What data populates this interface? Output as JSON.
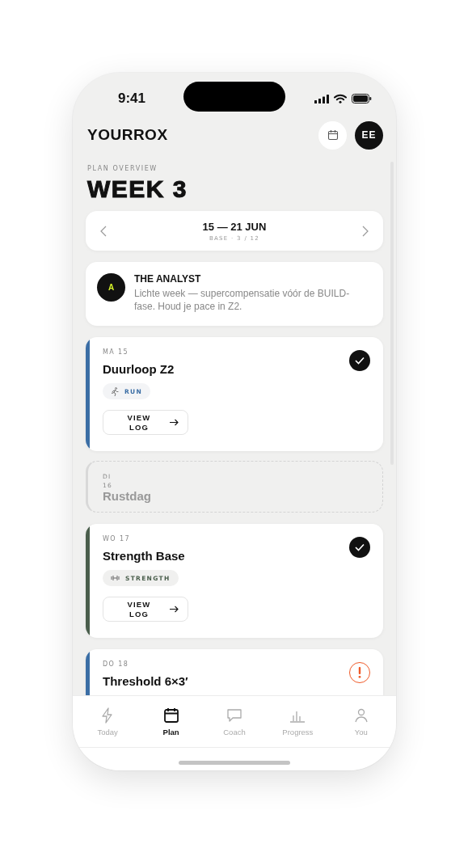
{
  "status_bar": {
    "time": "9:41"
  },
  "header": {
    "logo": "YOURROX",
    "avatar": "EE"
  },
  "overview": {
    "label": "PLAN OVERVIEW",
    "title": "WEEK 3"
  },
  "week_nav": {
    "range": "15 — 21 JUN",
    "phase": "BASE · 3 / 12"
  },
  "coach_note": {
    "avatar": "A",
    "title": "THE ANALYST",
    "text": "Lichte week — supercompensatie vóór de BUILD-fase. Houd je pace in Z2."
  },
  "days": [
    {
      "kind": "workout",
      "day": "MA 15",
      "title": "Duurloop Z2",
      "color": "#3b6ea5",
      "completed": true,
      "warning": false,
      "tag": {
        "kind": "run",
        "label": "RUN"
      },
      "action": "VIEW LOG"
    },
    {
      "kind": "rest",
      "day": "DI 16",
      "title": "Rustdag"
    },
    {
      "kind": "workout",
      "day": "WO 17",
      "title": "Strength Base",
      "color": "#4a5e4c",
      "completed": true,
      "warning": false,
      "tag": {
        "kind": "strength",
        "label": "STRENGTH"
      },
      "action": "VIEW LOG"
    },
    {
      "kind": "workout",
      "day": "DO 18",
      "title": "Threshold 6×3′",
      "color": "#3b6ea5",
      "completed": false,
      "warning": true
    }
  ],
  "tab_bar": [
    {
      "kind": "bolt",
      "label": "Today",
      "selected": false
    },
    {
      "kind": "calendar",
      "label": "Plan",
      "selected": true
    },
    {
      "kind": "chat",
      "label": "Coach",
      "selected": false
    },
    {
      "kind": "chart",
      "label": "Progress",
      "selected": false
    },
    {
      "kind": "person",
      "label": "You",
      "selected": false
    }
  ]
}
